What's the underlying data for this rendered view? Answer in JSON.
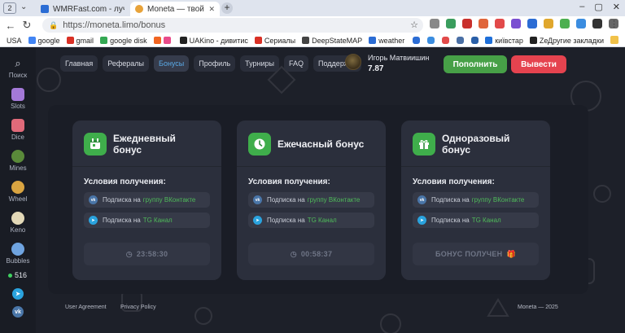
{
  "browser": {
    "tab_count": "2",
    "tabs": [
      {
        "title": "WMRFast.com - лучшее м",
        "favicon_color": "#2b6cd4"
      },
      {
        "title": "Moneta — твой путь к у",
        "favicon_color": "#e8a33a"
      }
    ],
    "new_tab": "+",
    "address": "https://moneta.limo/bonus",
    "bookmarks": [
      {
        "label": "USA",
        "color": "#ffffff"
      },
      {
        "label": "google",
        "color": "#4285f4"
      },
      {
        "label": "gmail",
        "color": "#d93025"
      },
      {
        "label": "google disk",
        "color": "#34a853"
      },
      {
        "label": "UAKino - дивитис",
        "color": "#222222"
      },
      {
        "label": "Сериалы",
        "color": "#d93025"
      },
      {
        "label": "DeepStateMAP",
        "color": "#444444"
      },
      {
        "label": "weather",
        "color": "#2b6cd4"
      }
    ],
    "bookmark_kyivstar": "київстар",
    "bookmark_ze": "Ze",
    "other_bookmarks": "Другие закладки"
  },
  "sidebar": {
    "items": [
      {
        "label": "Поиск",
        "icon": "search-icon"
      },
      {
        "label": "Slots",
        "icon": "slots-icon"
      },
      {
        "label": "Dice",
        "icon": "dice-icon"
      },
      {
        "label": "Mines",
        "icon": "mines-icon"
      },
      {
        "label": "Wheel",
        "icon": "wheel-icon"
      },
      {
        "label": "Keno",
        "icon": "keno-icon"
      },
      {
        "label": "Bubbles",
        "icon": "bubbles-icon"
      }
    ],
    "online": "516",
    "social": [
      "telegram-icon",
      "vk-icon"
    ]
  },
  "nav": {
    "links": [
      "Главная",
      "Рефералы",
      "Бонусы",
      "Профиль",
      "Турниры",
      "FAQ",
      "Поддержка"
    ],
    "active_index": 2
  },
  "user": {
    "name": "Игорь Матвиишин",
    "balance": "7.87"
  },
  "actions": {
    "deposit": "Пополнить",
    "withdraw": "Вывести"
  },
  "cards": [
    {
      "title_line1": "Ежедневный",
      "title_line2": "бонус",
      "icon": "calendar-icon",
      "conditions_title": "Условия получения:",
      "vk_prefix": "Подписка на",
      "vk_link": "группу ВКонтакте",
      "tg_prefix": "Подписка на",
      "tg_link": "TG Канал",
      "timer": "23:58:30"
    },
    {
      "title_line1": "Ежечасный бонус",
      "title_line2": "",
      "icon": "clock-icon",
      "conditions_title": "Условия получения:",
      "vk_prefix": "Подписка на",
      "vk_link": "группу ВКонтакте",
      "tg_prefix": "Подписка на",
      "tg_link": "TG Канал",
      "timer": "00:58:37"
    },
    {
      "title_line1": "Одноразовый",
      "title_line2": "бонус",
      "icon": "gift-icon",
      "conditions_title": "Условия получения:",
      "vk_prefix": "Подписка на",
      "vk_link": "группу ВКонтакте",
      "tg_prefix": "Подписка на",
      "tg_link": "TG Канал",
      "timer": "БОНУС ПОЛУЧЕН"
    }
  ],
  "footer": {
    "user_agreement": "User Agreement",
    "privacy": "Privacy Policy",
    "copyright": "Moneta — 2025"
  },
  "colors": {
    "accent_green": "#47a047",
    "accent_red": "#e5434f",
    "link_green": "#4fba5a",
    "active_nav": "#5aa9e6",
    "site_bg": "#1d2029"
  }
}
